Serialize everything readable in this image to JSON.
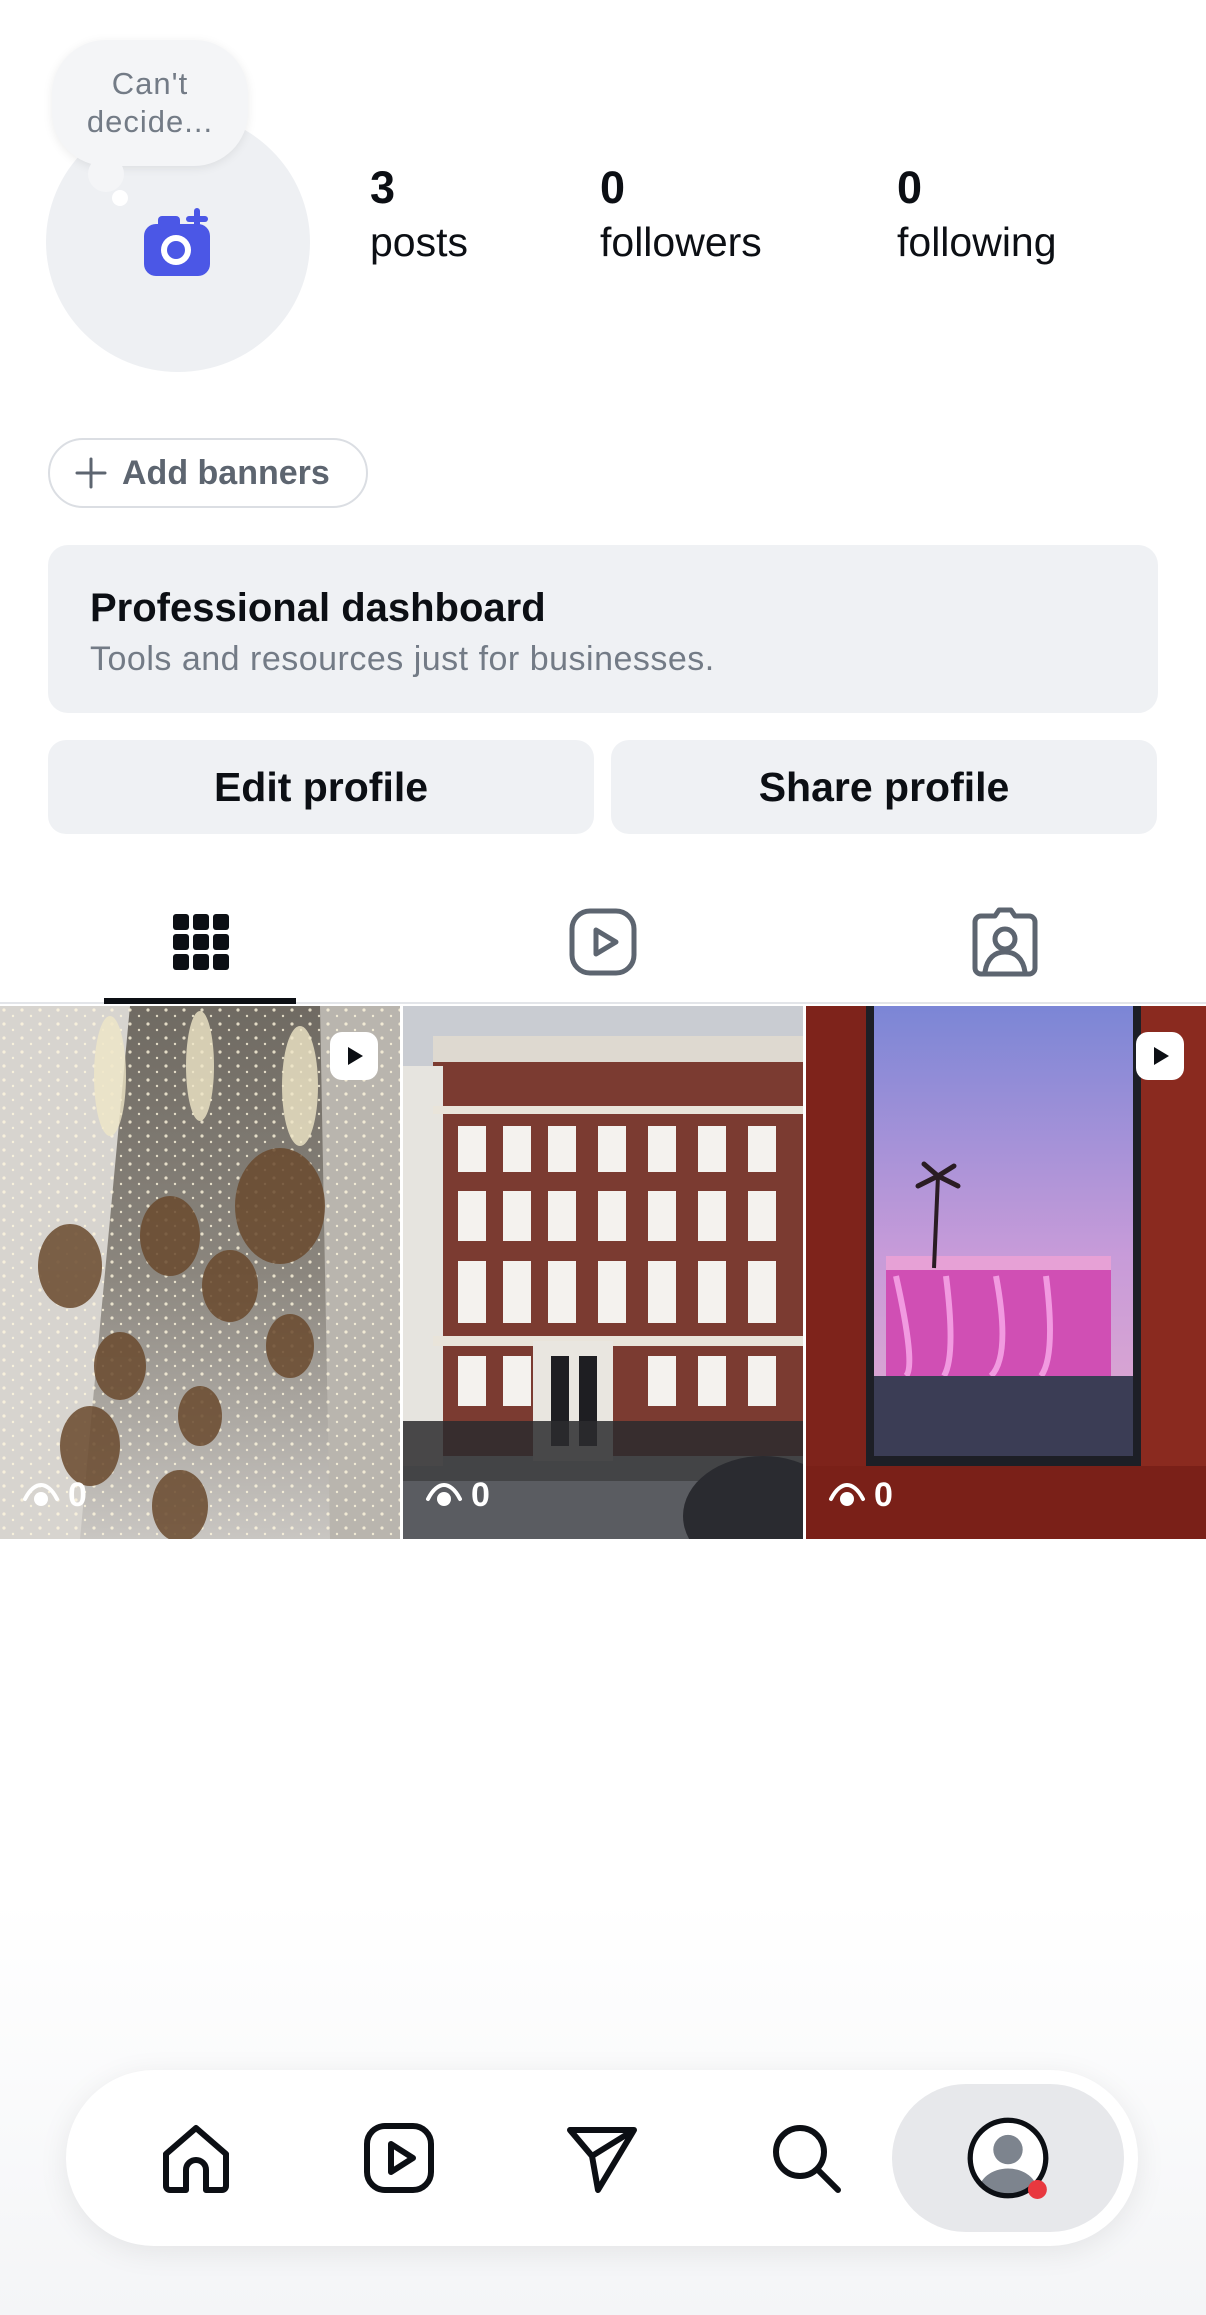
{
  "profile": {
    "note": "Can't decide...",
    "stats": [
      {
        "value": "3",
        "label": "posts"
      },
      {
        "value": "0",
        "label": "followers"
      },
      {
        "value": "0",
        "label": "following"
      }
    ],
    "add_banners_label": "Add banners",
    "add_icon": "plus-icon",
    "avatar_icon": "add-photo-camera-icon",
    "accent_color": "#4b57e6"
  },
  "dashboard": {
    "title": "Professional dashboard",
    "subtitle": "Tools and resources just for businesses."
  },
  "actions": {
    "edit": "Edit profile",
    "share": "Share profile"
  },
  "tabs": [
    {
      "icon": "grid-icon",
      "active": true
    },
    {
      "icon": "reels-icon",
      "active": false
    },
    {
      "icon": "tagged-icon",
      "active": false
    }
  ],
  "posts": [
    {
      "subject": "birdcage-lights",
      "views": "0",
      "is_reel": true
    },
    {
      "subject": "brick-townhouse",
      "views": "0",
      "is_reel": false
    },
    {
      "subject": "pink-building-frame",
      "views": "0",
      "is_reel": true
    }
  ],
  "nav": [
    {
      "icon": "home-icon",
      "active": false
    },
    {
      "icon": "reels-icon",
      "active": false
    },
    {
      "icon": "send-icon",
      "active": false
    },
    {
      "icon": "search-icon",
      "active": false
    },
    {
      "icon": "profile-icon",
      "active": true,
      "badge_color": "#e8383f"
    }
  ]
}
